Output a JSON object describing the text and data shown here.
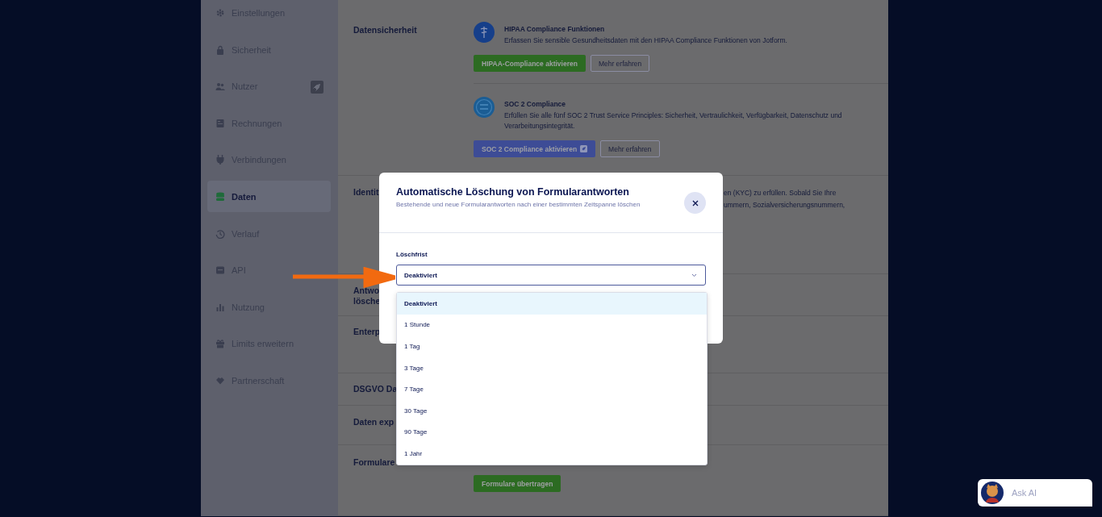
{
  "sidebar": {
    "items": [
      {
        "label": "Einstellungen",
        "selected": false,
        "upgrade_badge": false
      },
      {
        "label": "Sicherheit",
        "selected": false,
        "upgrade_badge": false
      },
      {
        "label": "Nutzer",
        "selected": false,
        "upgrade_badge": true
      },
      {
        "label": "Rechnungen",
        "selected": false,
        "upgrade_badge": false
      },
      {
        "label": "Verbindungen",
        "selected": false,
        "upgrade_badge": false
      },
      {
        "label": "Daten",
        "selected": true,
        "upgrade_badge": false
      },
      {
        "label": "Verlauf",
        "selected": false,
        "upgrade_badge": false
      },
      {
        "label": "API",
        "selected": false,
        "upgrade_badge": false
      },
      {
        "label": "Nutzung",
        "selected": false,
        "upgrade_badge": false
      },
      {
        "label": "Limits erweitern",
        "selected": false,
        "upgrade_badge": false
      },
      {
        "label": "Partnerschaft",
        "selected": false,
        "upgrade_badge": false
      }
    ]
  },
  "sections": [
    {
      "kind": "features",
      "label": "Datensicherheit",
      "features": [
        {
          "kind": "hipaa",
          "title": "HIPAA Compliance Funktionen",
          "description": "Erfassen Sie sensible Gesundheitsdaten mit den HIPAA Compliance Funktionen von Jotform.",
          "primary_button": {
            "label": "HIPAA-Compliance aktivieren",
            "color": "#2c6b22",
            "upgrade_badge": false
          },
          "secondary_button": "Mehr erfahren"
        },
        {
          "kind": "soc",
          "title": "SOC 2 Compliance",
          "description": "Erfüllen Sie alle fünf SOC 2 Trust Service Principles: Sicherheit, Vertraulichkeit, Verfügbarkeit, Datenschutz und Verarbeitungsintegrität.",
          "primary_button": {
            "label": "SOC 2 Compliance aktivieren",
            "color": "#3d4c96",
            "upgrade_badge": true
          },
          "secondary_button": "Mehr erfahren"
        }
      ]
    },
    {
      "kind": "partial",
      "label": "Identit",
      "fragments": [
        "en (KYC) zu erfüllen. Sobald Sie Ihre",
        "ummern, Sozialversicherungsnummern,"
      ]
    },
    {
      "kind": "plain",
      "label": "Antwo\nlösche"
    },
    {
      "kind": "plain",
      "label": "Enterp"
    },
    {
      "kind": "plain",
      "label": "DSGVO Da"
    },
    {
      "kind": "plain",
      "label": "Daten exp"
    },
    {
      "kind": "action",
      "label": "Formulare",
      "button": "Formulare übertragen"
    }
  ],
  "modal": {
    "title": "Automatische Löschung von Formularantworten",
    "subtitle": "Bestehende und neue Formularantworten nach einer bestimmten Zeitspanne löschen",
    "field_label": "Löschfrist",
    "value": "Deaktiviert",
    "options": [
      {
        "label": "Deaktiviert",
        "selected": true
      },
      {
        "label": "1 Stunde",
        "selected": false
      },
      {
        "label": "1 Tag",
        "selected": false
      },
      {
        "label": "3 Tage",
        "selected": false
      },
      {
        "label": "7 Tage",
        "selected": false
      },
      {
        "label": "30 Tage",
        "selected": false
      },
      {
        "label": "90 Tage",
        "selected": false
      },
      {
        "label": "1 Jahr",
        "selected": false
      }
    ]
  },
  "assistant": {
    "label": "Ask AI"
  }
}
